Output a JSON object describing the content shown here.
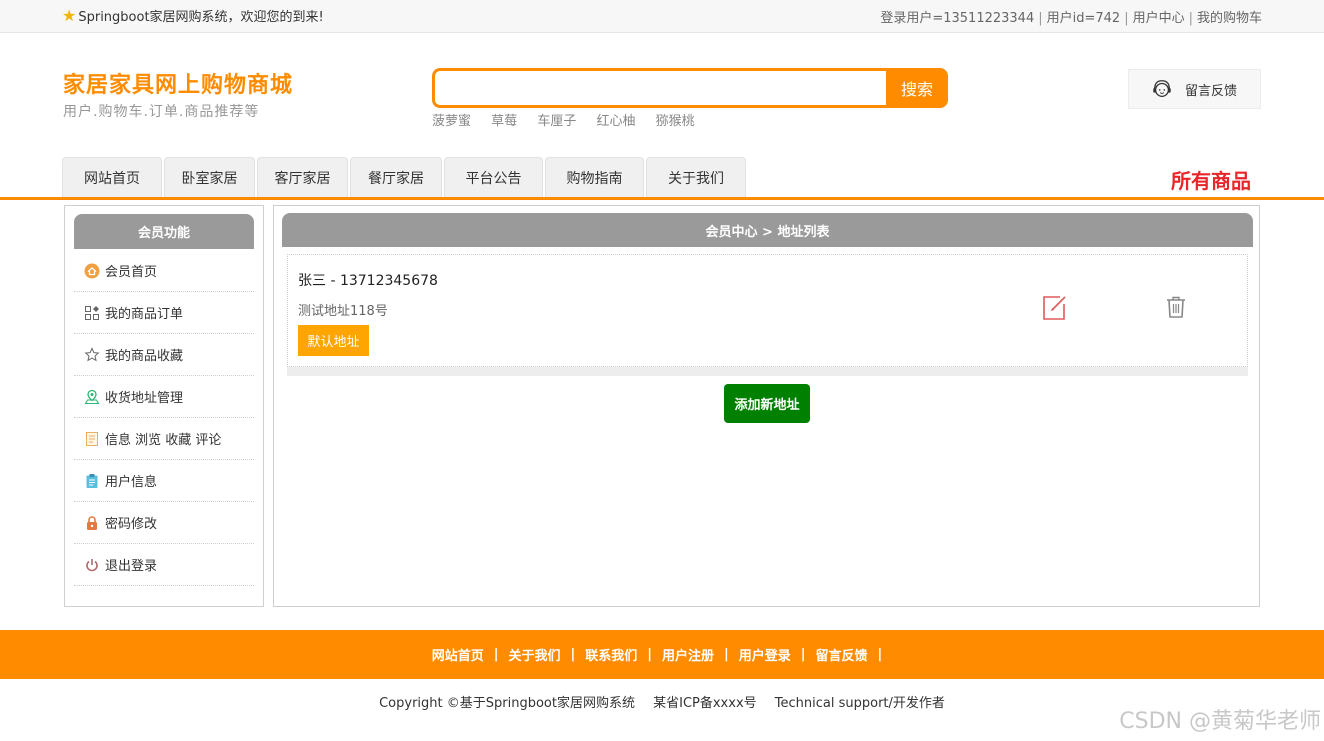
{
  "topbar": {
    "welcome": "Springboot家居网购系统，欢迎您的到来!",
    "links": [
      "登录用户=13511223344",
      "用户id=742",
      "用户中心",
      "我的购物车"
    ]
  },
  "logo": {
    "title": "家居家具网上购物商城",
    "subtitle": "用户.购物车.订单.商品推荐等"
  },
  "search": {
    "value": "",
    "placeholder": "",
    "button": "搜索",
    "hot": [
      "菠萝蜜",
      "草莓",
      "车厘子",
      "红心柚",
      "猕猴桃"
    ]
  },
  "feedback": {
    "label": "留言反馈"
  },
  "nav": {
    "tabs": [
      "网站首页",
      "卧室家居",
      "客厅家居",
      "餐厅家居",
      "平台公告",
      "购物指南",
      "关于我们"
    ],
    "all_goods": "所有商品"
  },
  "sidebar": {
    "title": "会员功能",
    "items": [
      {
        "label": "会员首页",
        "icon": "home-icon"
      },
      {
        "label": "我的商品订单",
        "icon": "orders-grid-icon"
      },
      {
        "label": "我的商品收藏",
        "icon": "star-icon"
      },
      {
        "label": "收货地址管理",
        "icon": "location-icon"
      },
      {
        "label": "信息 浏览 收藏 评论",
        "icon": "document-icon"
      },
      {
        "label": "用户信息",
        "icon": "clipboard-icon"
      },
      {
        "label": "密码修改",
        "icon": "lock-icon"
      },
      {
        "label": "退出登录",
        "icon": "power-icon"
      }
    ]
  },
  "main": {
    "breadcrumb": "会员中心 > 地址列表",
    "address": {
      "name_phone": "张三 - 13712345678",
      "detail": "测试地址118号",
      "default_label": "默认地址"
    },
    "add_button": "添加新地址"
  },
  "footer": {
    "links": [
      "网站首页",
      "关于我们",
      "联系我们",
      "用户注册",
      "用户登录",
      "留言反馈"
    ],
    "separator": "|",
    "copyright": [
      "Copyright ©基于Springboot家居网购系统",
      "某省ICP备xxxx号",
      "Technical support/开发作者"
    ]
  },
  "watermark": "CSDN @黄菊华老师",
  "colors": {
    "accent": "#ff8c00",
    "all_goods": "#e8262a",
    "add_button": "#008000",
    "default_badge": "#ffa500",
    "header_gray": "#9a9a9a"
  }
}
